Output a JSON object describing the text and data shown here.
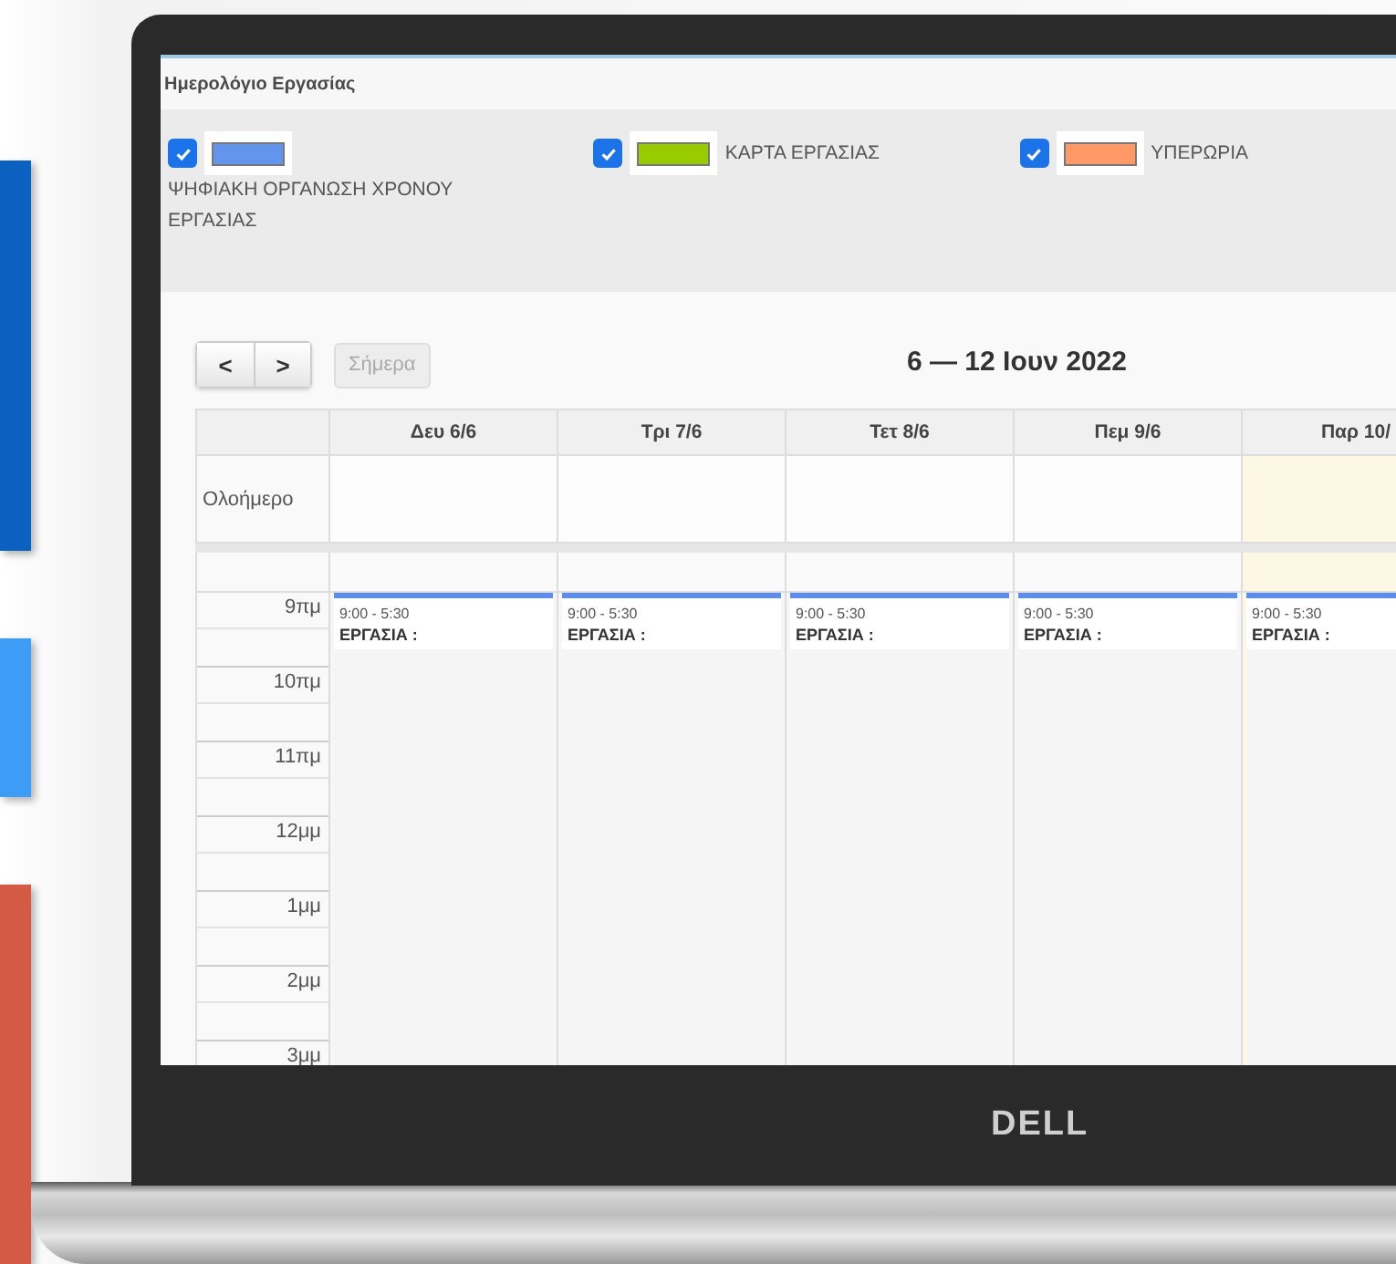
{
  "window": {
    "title": "Ημερολόγιο Εργασίας"
  },
  "legend": [
    {
      "checked": true,
      "color": "#6495ed",
      "label": "ΨΗΦΙΑΚΗ ΟΡΓΑΝΩΣΗ ΧΡΟΝΟΥ ΕΡΓΑΣΙΑΣ"
    },
    {
      "checked": true,
      "color": "#99cc00",
      "label": "ΚΑΡΤΑ ΕΡΓΑΣΙΑΣ"
    },
    {
      "checked": true,
      "color": "#ff9966",
      "label": "ΥΠΕΡΩΡΙΑ"
    }
  ],
  "toolbar": {
    "prev": "<",
    "next": ">",
    "today_button": {
      "label": "Σήμερα",
      "disabled": true
    },
    "range_title": "6 — 12 Ιουν 2022"
  },
  "calendar": {
    "all_day_label": "Ολοήμερο",
    "days": [
      {
        "label": "Δευ 6/6",
        "today": false,
        "event": {
          "time": "9:00 - 5:30",
          "title": "ΕΡΓΑΣΙΑ :"
        }
      },
      {
        "label": "Τρι 7/6",
        "today": false,
        "event": {
          "time": "9:00 - 5:30",
          "title": "ΕΡΓΑΣΙΑ :"
        }
      },
      {
        "label": "Τετ 8/6",
        "today": false,
        "event": {
          "time": "9:00 - 5:30",
          "title": "ΕΡΓΑΣΙΑ :"
        }
      },
      {
        "label": "Πεμ 9/6",
        "today": false,
        "event": {
          "time": "9:00 - 5:30",
          "title": "ΕΡΓΑΣΙΑ :"
        }
      },
      {
        "label": "Παρ 10/",
        "today": true,
        "event": {
          "time": "9:00 - 5:30",
          "title": "ΕΡΓΑΣΙΑ :"
        }
      }
    ],
    "hours": [
      "9πμ",
      "10πμ",
      "11πμ",
      "12μμ",
      "1μμ",
      "2μμ",
      "3μμ"
    ]
  },
  "laptop": {
    "brand": "DELL"
  }
}
